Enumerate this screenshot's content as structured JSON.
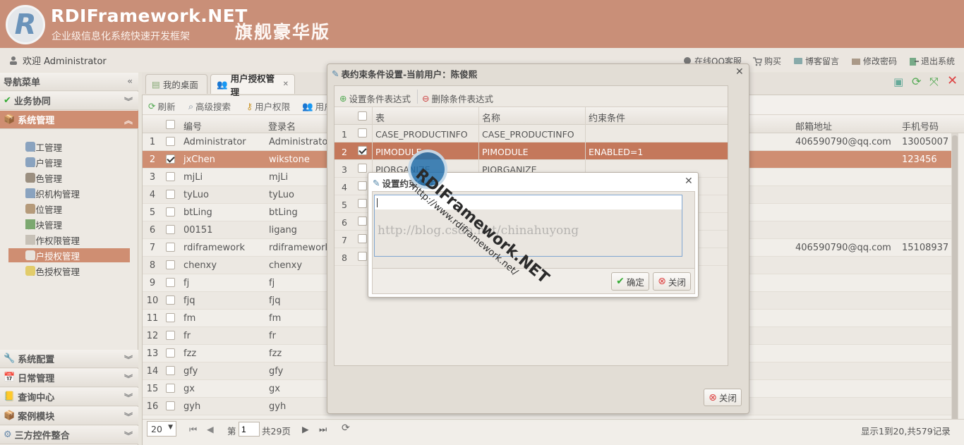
{
  "header": {
    "brand": "RDIFramework.NET",
    "subtitle": "企业级信息化系统快速开发框架",
    "edition": "旗舰豪华版",
    "logo_letter": "R"
  },
  "topbar": {
    "welcome": "欢迎 Administrator",
    "links": [
      "在线QQ客服",
      "购买",
      "博客留言",
      "修改密码",
      "退出系统"
    ]
  },
  "nav": {
    "title": "导航菜单",
    "groups": {
      "business": "业务协同",
      "system": "系统管理",
      "config": "系统配置",
      "daily": "日常管理",
      "query": "查询中心",
      "cases": "案例模块",
      "thirdparty": "三方控件整合"
    },
    "items": [
      "员工管理",
      "用户管理",
      "角色管理",
      "组织机构管理",
      "岗位管理",
      "模块管理",
      "操作权限管理",
      "用户授权管理",
      "角色授权管理"
    ]
  },
  "tabs": [
    "我的桌面",
    "用户授权管理"
  ],
  "toolbar": [
    "刷新",
    "高级搜索",
    "用户权限",
    "用户"
  ],
  "grid": {
    "columns": {
      "no": "编号",
      "login": "登录名",
      "email": "邮箱地址",
      "phone": "手机号码"
    },
    "rows": [
      {
        "n": "1",
        "no": "Administrator",
        "login": "Administrator",
        "email": "406590790@qq.com",
        "phone": "13005007"
      },
      {
        "n": "2",
        "no": "jxChen",
        "login": "wikstone",
        "email": "",
        "phone": "123456"
      },
      {
        "n": "3",
        "no": "mjLi",
        "login": "mjLi",
        "email": "",
        "phone": ""
      },
      {
        "n": "4",
        "no": "tyLuo",
        "login": "tyLuo",
        "email": "",
        "phone": ""
      },
      {
        "n": "5",
        "no": "btLing",
        "login": "btLing",
        "email": "",
        "phone": ""
      },
      {
        "n": "6",
        "no": "00151",
        "login": "ligang",
        "email": "",
        "phone": ""
      },
      {
        "n": "7",
        "no": "rdiframework",
        "login": "rdiframework",
        "email": "406590790@qq.com",
        "phone": "15108937"
      },
      {
        "n": "8",
        "no": "chenxy",
        "login": "chenxy",
        "email": "",
        "phone": ""
      },
      {
        "n": "9",
        "no": "fj",
        "login": "fj",
        "email": "",
        "phone": ""
      },
      {
        "n": "10",
        "no": "fjq",
        "login": "fjq",
        "email": "",
        "phone": ""
      },
      {
        "n": "11",
        "no": "fm",
        "login": "fm",
        "email": "",
        "phone": ""
      },
      {
        "n": "12",
        "no": "fr",
        "login": "fr",
        "email": "",
        "phone": ""
      },
      {
        "n": "13",
        "no": "fzz",
        "login": "fzz",
        "email": "",
        "phone": ""
      },
      {
        "n": "14",
        "no": "gfy",
        "login": "gfy",
        "email": "",
        "phone": ""
      },
      {
        "n": "15",
        "no": "gx",
        "login": "gx",
        "email": "",
        "phone": ""
      },
      {
        "n": "16",
        "no": "gyh",
        "login": "gyh",
        "email": "",
        "phone": ""
      }
    ]
  },
  "pager": {
    "page_size": "20",
    "page_prefix": "第",
    "page": "1",
    "page_suffix": "共29页",
    "summary": "显示1到20,共579记录"
  },
  "dialog_outer": {
    "title": "表约束条件设置-当前用户：陈俊熙",
    "btn_set": "设置条件表达式",
    "btn_delete": "删除条件表达式",
    "columns": {
      "table": "表",
      "name": "名称",
      "cond": "约束条件"
    },
    "rows": [
      {
        "n": "1",
        "table": "CASE_PRODUCTINFO",
        "name": "CASE_PRODUCTINFO",
        "cond": ""
      },
      {
        "n": "2",
        "table": "PIMODULE",
        "name": "PIMODULE",
        "cond": "ENABLED=1"
      },
      {
        "n": "3",
        "table": "PIORGANIZE",
        "name": "PIORGANIZE",
        "cond": ""
      },
      {
        "n": "4",
        "table": "",
        "name": "",
        "cond": ""
      },
      {
        "n": "5",
        "table": "",
        "name": "",
        "cond": ""
      },
      {
        "n": "6",
        "table": "",
        "name": "",
        "cond": ""
      },
      {
        "n": "7",
        "table": "",
        "name": "",
        "cond": ""
      },
      {
        "n": "8",
        "table": "",
        "name": "",
        "cond": ""
      }
    ],
    "close": "关闭"
  },
  "dialog_inner": {
    "title": "设置约束条件",
    "textarea_value": "",
    "ok": "确定",
    "close": "关闭"
  },
  "watermark": {
    "brand": "RDIFramework.NET",
    "url": "http://www.rdiframework.net/",
    "blog": "http://blog.csdn.net/chinahuyong"
  },
  "colors": {
    "header": "#c98f78",
    "accent": "#cf8e72",
    "selected_row": "#c4785b"
  }
}
